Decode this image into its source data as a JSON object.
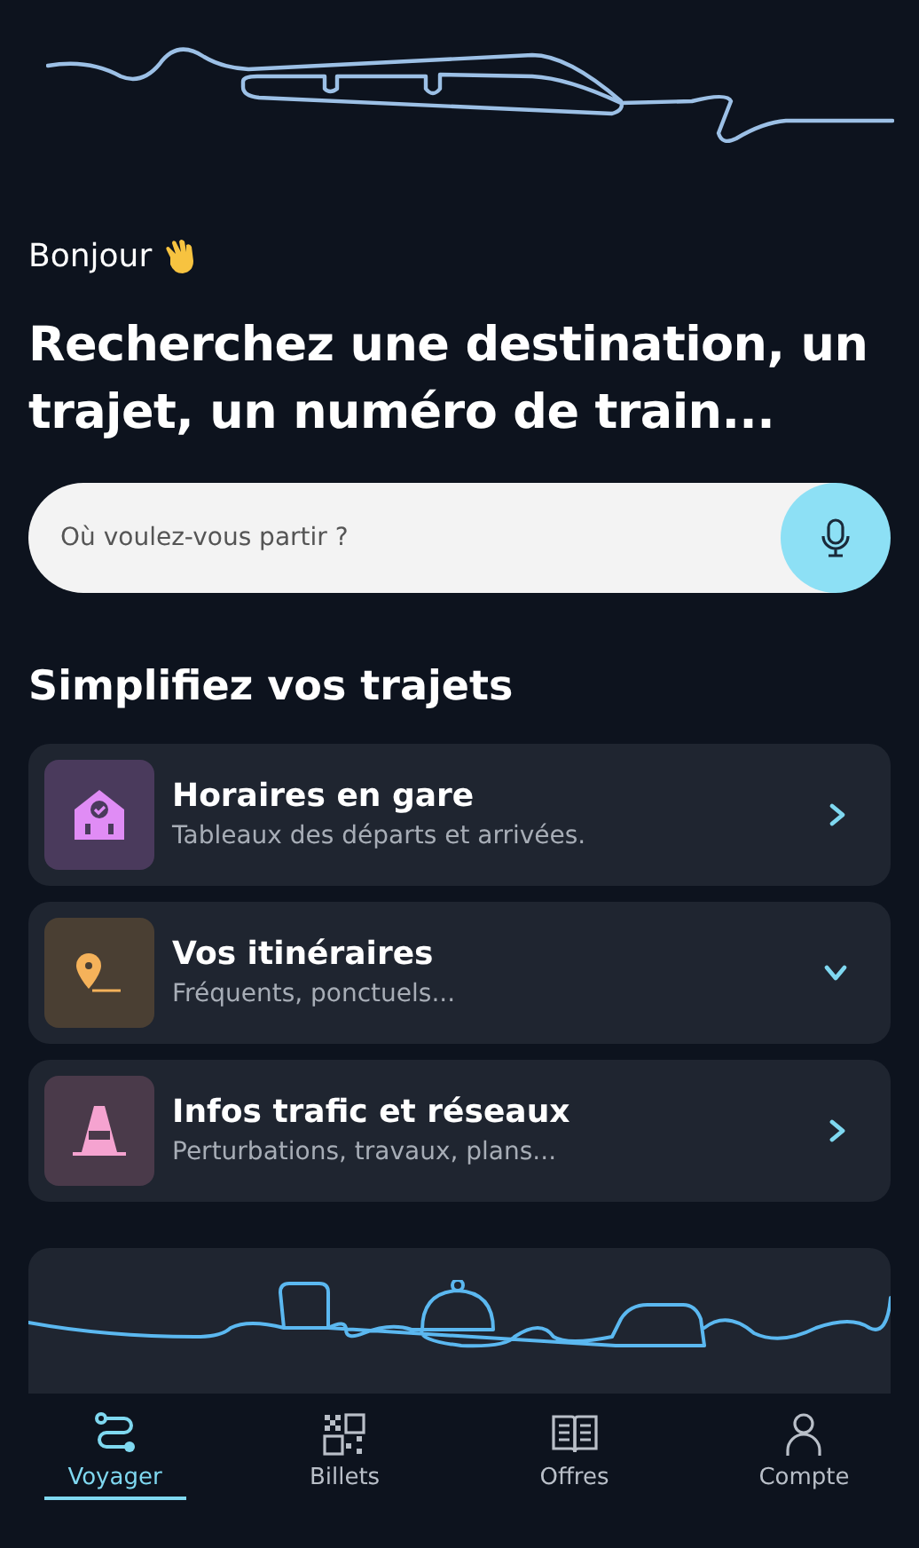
{
  "greeting": "Bonjour",
  "headline": "Recherchez une destination, un trajet, un numéro de train...",
  "search": {
    "placeholder": "Où voulez-vous partir ?"
  },
  "section_title": "Simplifiez vos trajets",
  "cards": [
    {
      "kind": "link",
      "title": "Horaires en gare",
      "subtitle": "Tableaux des départs et arrivées."
    },
    {
      "kind": "expandable",
      "title": "Vos itinéraires",
      "subtitle": "Fréquents, ponctuels..."
    },
    {
      "kind": "link",
      "title": "Infos trafic et réseaux",
      "subtitle": "Perturbations, travaux, plans..."
    }
  ],
  "nav": [
    {
      "label": "Voyager",
      "selected": true
    },
    {
      "label": "Billets",
      "selected": false
    },
    {
      "label": "Offres",
      "selected": false
    },
    {
      "label": "Compte",
      "selected": false
    }
  ]
}
